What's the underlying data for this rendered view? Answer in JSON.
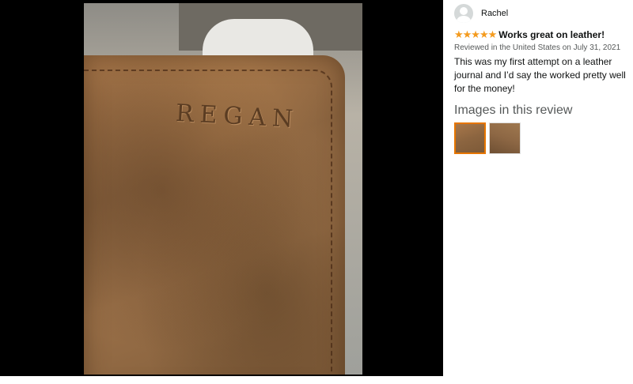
{
  "photo": {
    "embossed_text": "REGAN"
  },
  "review": {
    "reviewer": "Rachel",
    "rating": 5,
    "stars": "★★★★★",
    "title": "Works great on leather!",
    "date_line": "Reviewed in the United States on July 31, 2021",
    "body": "This was my first attempt on a leather journal and I’d say the worked pretty well for the money!",
    "images_heading": "Images in this review",
    "thumbnails_count": 2
  },
  "colors": {
    "star": "#f49b1e",
    "selected_border": "#e77600"
  }
}
